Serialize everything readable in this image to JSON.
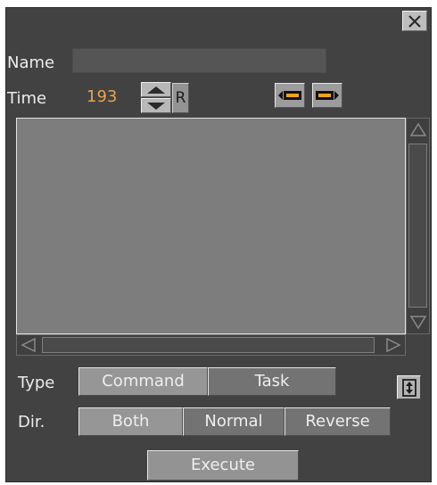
{
  "window": {
    "close_icon": "close-icon"
  },
  "name_field": {
    "label": "Name",
    "value": ""
  },
  "time_field": {
    "label": "Time",
    "value": "193",
    "reset_label": "R",
    "value_color": "#e8a54a"
  },
  "navigation": {
    "prev_icon": "step-back-icon",
    "next_icon": "step-forward-icon"
  },
  "type_selector": {
    "label": "Type",
    "options": [
      "Command",
      "Task"
    ],
    "selected": "Command"
  },
  "direction_selector": {
    "label": "Dir.",
    "options": [
      "Both",
      "Normal",
      "Reverse"
    ],
    "selected": "Both"
  },
  "expand_icon": "expand-vertical-icon",
  "execute_label": "Execute"
}
